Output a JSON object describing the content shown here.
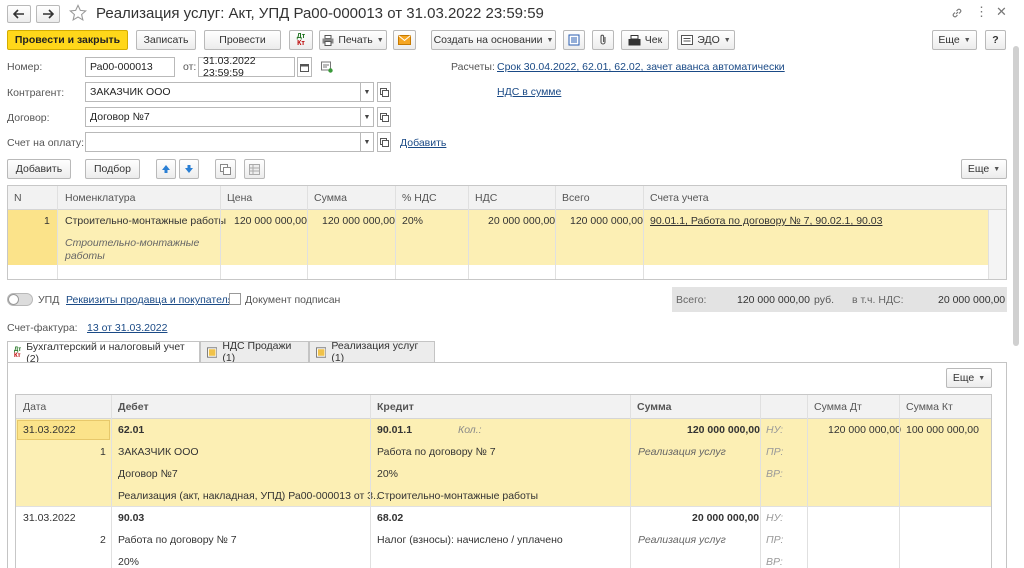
{
  "window": {
    "title": "Реализация услуг: Акт, УПД Ра00-000013 от 31.03.2022 23:59:59"
  },
  "toolbar": {
    "post_close": "Провести и закрыть",
    "save": "Записать",
    "post": "Провести",
    "print": "Печать",
    "create_basis": "Создать на основании",
    "check": "Чек",
    "edo": "ЭДО",
    "more": "Еще",
    "help": "?"
  },
  "header": {
    "number_label": "Номер:",
    "number_value": "Ра00-000013",
    "date_label": "от:",
    "date_value": "31.03.2022 23:59:59",
    "settlements_label": "Расчеты:",
    "settlements_link": "Срок 30.04.2022, 62.01, 62.02, зачет аванса автоматически",
    "vat_link": "НДС в сумме",
    "contractor_label": "Контрагент:",
    "contractor_value": "ЗАКАЗЧИК ООО",
    "contract_label": "Договор:",
    "contract_value": "Договор №7",
    "invoice_label": "Счет на оплату:",
    "invoice_value": "",
    "add_link": "Добавить"
  },
  "items_toolbar": {
    "add": "Добавить",
    "pick": "Подбор",
    "more": "Еще"
  },
  "items_table": {
    "columns": [
      "N",
      "Номенклатура",
      "Цена",
      "Сумма",
      "% НДС",
      "НДС",
      "Всего",
      "Счета учета"
    ],
    "rows": [
      {
        "n": "1",
        "name": "Строительно-монтажные работы",
        "name_sub1": "Строительно-монтажные",
        "name_sub2": "работы",
        "price": "120 000 000,00",
        "sum": "120 000 000,00",
        "vat_rate": "20%",
        "vat": "20 000 000,00",
        "total": "120 000 000,00",
        "accounts": "90.01.1, Работа по договору № 7, 90.02.1, 90.03"
      }
    ]
  },
  "footer": {
    "upd_label": "УПД",
    "requisites_link": "Реквизиты продавца и покупателя",
    "signed_label": "Документ подписан",
    "total_label": "Всего:",
    "total_value": "120 000 000,00",
    "currency": "руб.",
    "vat_label": "в т.ч. НДС:",
    "vat_value": "20 000 000,00",
    "invoice_label": "Счет-фактура:",
    "invoice_link": "13 от 31.03.2022"
  },
  "tabs": [
    {
      "label": "Бухгалтерский и налоговый учет (2)",
      "active": true
    },
    {
      "label": "НДС Продажи (1)",
      "active": false
    },
    {
      "label": "Реализация услуг (1)",
      "active": false
    }
  ],
  "entries_toolbar": {
    "more": "Еще"
  },
  "entries_table": {
    "columns": [
      "Дата",
      "Дебет",
      "Кредит",
      "Сумма",
      "Сумма Дт",
      "Сумма Кт"
    ],
    "rows": [
      {
        "date": "31.03.2022",
        "n": "1",
        "debit_acc": "62.01",
        "debit_1": "ЗАКАЗЧИК ООО",
        "debit_2": "Договор №7",
        "debit_3": "Реализация (акт, накладная, УПД) Ра00-000013 от 3...",
        "credit_acc": "90.01.1",
        "qty_label": "Кол.:",
        "credit_1": "Работа по договору № 7",
        "credit_2": "20%",
        "credit_3": "Строительно-монтажные работы",
        "sum": "120 000 000,00",
        "content": "Реализация услуг",
        "nu": "НУ:",
        "pr": "ПР:",
        "vr": "ВР:",
        "sum_dt": "120 000 000,00",
        "sum_kt": "100 000 000,00"
      },
      {
        "date": "31.03.2022",
        "n": "2",
        "debit_acc": "90.03",
        "debit_1": "Работа по договору № 7",
        "debit_2": "20%",
        "credit_acc": "68.02",
        "credit_1": "Налог (взносы): начислено / уплачено",
        "sum": "20 000 000,00",
        "content": "Реализация услуг",
        "nu": "НУ:",
        "pr": "ПР:",
        "vr": "ВР:"
      }
    ]
  },
  "colors": {
    "accent_yellow": "#ffd71a",
    "selected_row": "#fcefb4",
    "link": "#1a4a86"
  }
}
